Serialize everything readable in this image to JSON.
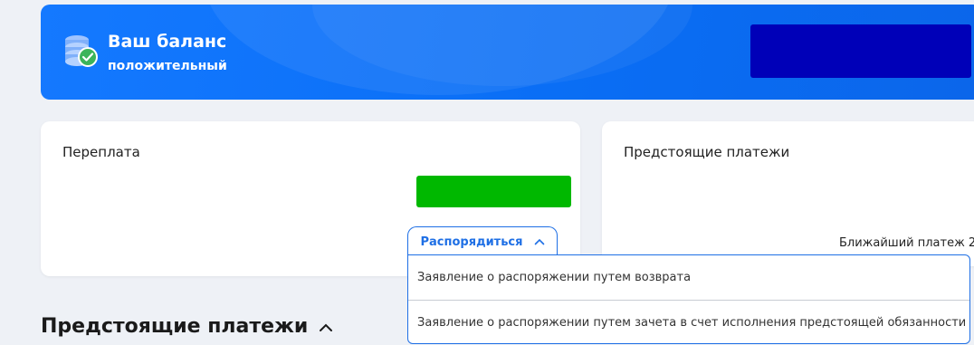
{
  "banner": {
    "title": "Ваш баланс",
    "subtitle": "положительный",
    "icon": "coins-check-icon",
    "redacted_color": "#0000b8"
  },
  "overpayment": {
    "title": "Переплата",
    "redacted_color": "#00b800",
    "dispose_label": "Распорядиться"
  },
  "upcoming_card": {
    "title": "Предстоящие платежи",
    "nearest_label": "Ближайший платеж 2"
  },
  "section": {
    "title": "Предстоящие платежи"
  },
  "dropdown": {
    "items": [
      "Заявление о распоряжении путем возврата",
      "Заявление о распоряжении путем зачета в счет исполнения предстоящей обязанности"
    ]
  },
  "colors": {
    "accent": "#1e6fe5",
    "banner": "#0a6ef5",
    "background": "#eef1f6"
  }
}
